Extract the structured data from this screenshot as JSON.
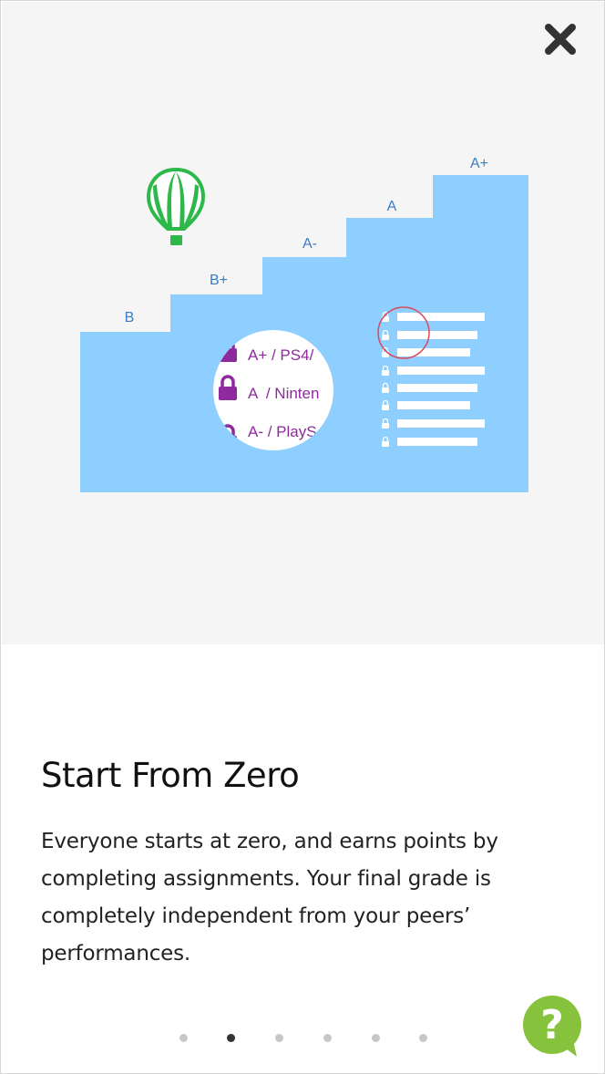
{
  "close_icon": "close-icon",
  "illustration": {
    "step_labels": [
      "B",
      "B+",
      "A-",
      "A",
      "A+"
    ],
    "magnifier_rows": [
      "A+ / PS4/",
      "A  / Ninten",
      "A- / PlayS"
    ],
    "colors": {
      "stairs": "#8fcfff",
      "label": "#3b7cc6",
      "balloon": "#2fb84a",
      "lock": "#8e2a9e",
      "highlight_circle": "#d94a5c"
    }
  },
  "slide": {
    "title": "Start From Zero",
    "body": "Everyone starts at zero, and earns points by completing assignments. Your final grade is completely independent from your peers’ performances."
  },
  "pagination": {
    "count": 6,
    "active_index": 1
  },
  "help": {
    "icon": "help-icon",
    "glyph": "?",
    "color": "#86c23b"
  }
}
